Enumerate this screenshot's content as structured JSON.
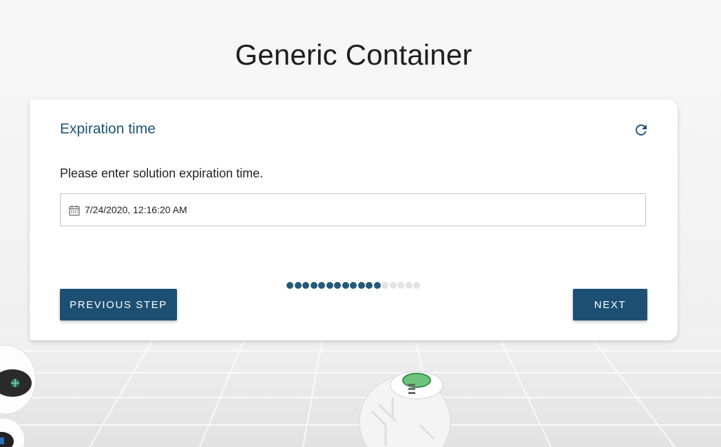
{
  "page": {
    "title": "Generic Container"
  },
  "card": {
    "title": "Expiration time",
    "refresh_icon": "refresh-icon",
    "instruction": "Please enter solution expiration time.",
    "date_input": {
      "icon": "calendar-icon",
      "value": "7/24/2020, 12:16:20 AM"
    },
    "progress": {
      "completed_steps": 12,
      "total_steps": 17
    },
    "buttons": {
      "previous_label": "PREVIOUS STEP",
      "next_label": "NEXT"
    }
  },
  "colors": {
    "accent": "#1d4f72",
    "title_text": "#1f5577",
    "step_done": "#275778",
    "step_todo": "#e3e3e3"
  }
}
